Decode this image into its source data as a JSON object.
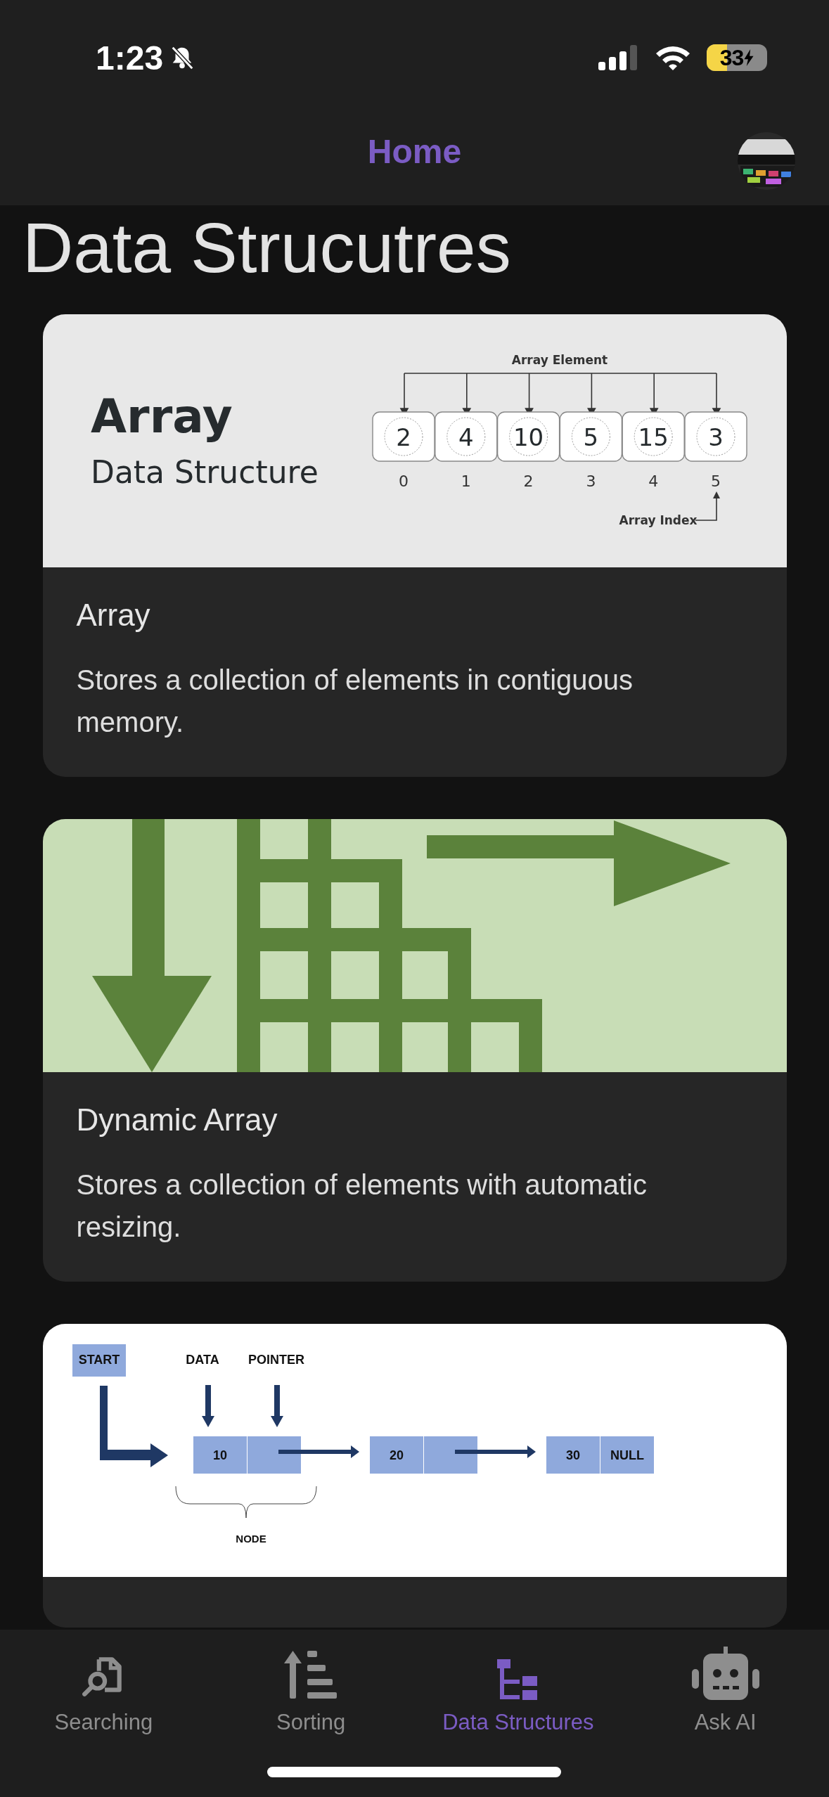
{
  "status_bar": {
    "time": "1:23",
    "battery": "33"
  },
  "header": {
    "title": "Home"
  },
  "page_title": "Data Strucutres",
  "cards": [
    {
      "kind": "array",
      "figure": {
        "heading": "Array",
        "subheading": "Data Structure",
        "top_label": "Array Element",
        "elements": [
          "2",
          "4",
          "10",
          "5",
          "15",
          "3"
        ],
        "indices": [
          "0",
          "1",
          "2",
          "3",
          "4",
          "5"
        ],
        "bottom_label": "Array Index"
      },
      "title": "Array",
      "description": "Stores a collection of elements in contiguous memory."
    },
    {
      "kind": "dynamic",
      "title": "Dynamic Array",
      "description": "Stores a collection of elements with automatic resizing."
    },
    {
      "kind": "linked",
      "figure": {
        "start": "START",
        "data_label": "DATA",
        "pointer_label": "POINTER",
        "node_label": "NODE",
        "nodes": [
          {
            "data": "10"
          },
          {
            "data": "20"
          },
          {
            "data": "30",
            "pointer": "NULL"
          }
        ]
      }
    }
  ],
  "tabs": [
    {
      "label": "Searching",
      "selected": false
    },
    {
      "label": "Sorting",
      "selected": false
    },
    {
      "label": "Data Structures",
      "selected": true
    },
    {
      "label": "Ask AI",
      "selected": false
    }
  ]
}
